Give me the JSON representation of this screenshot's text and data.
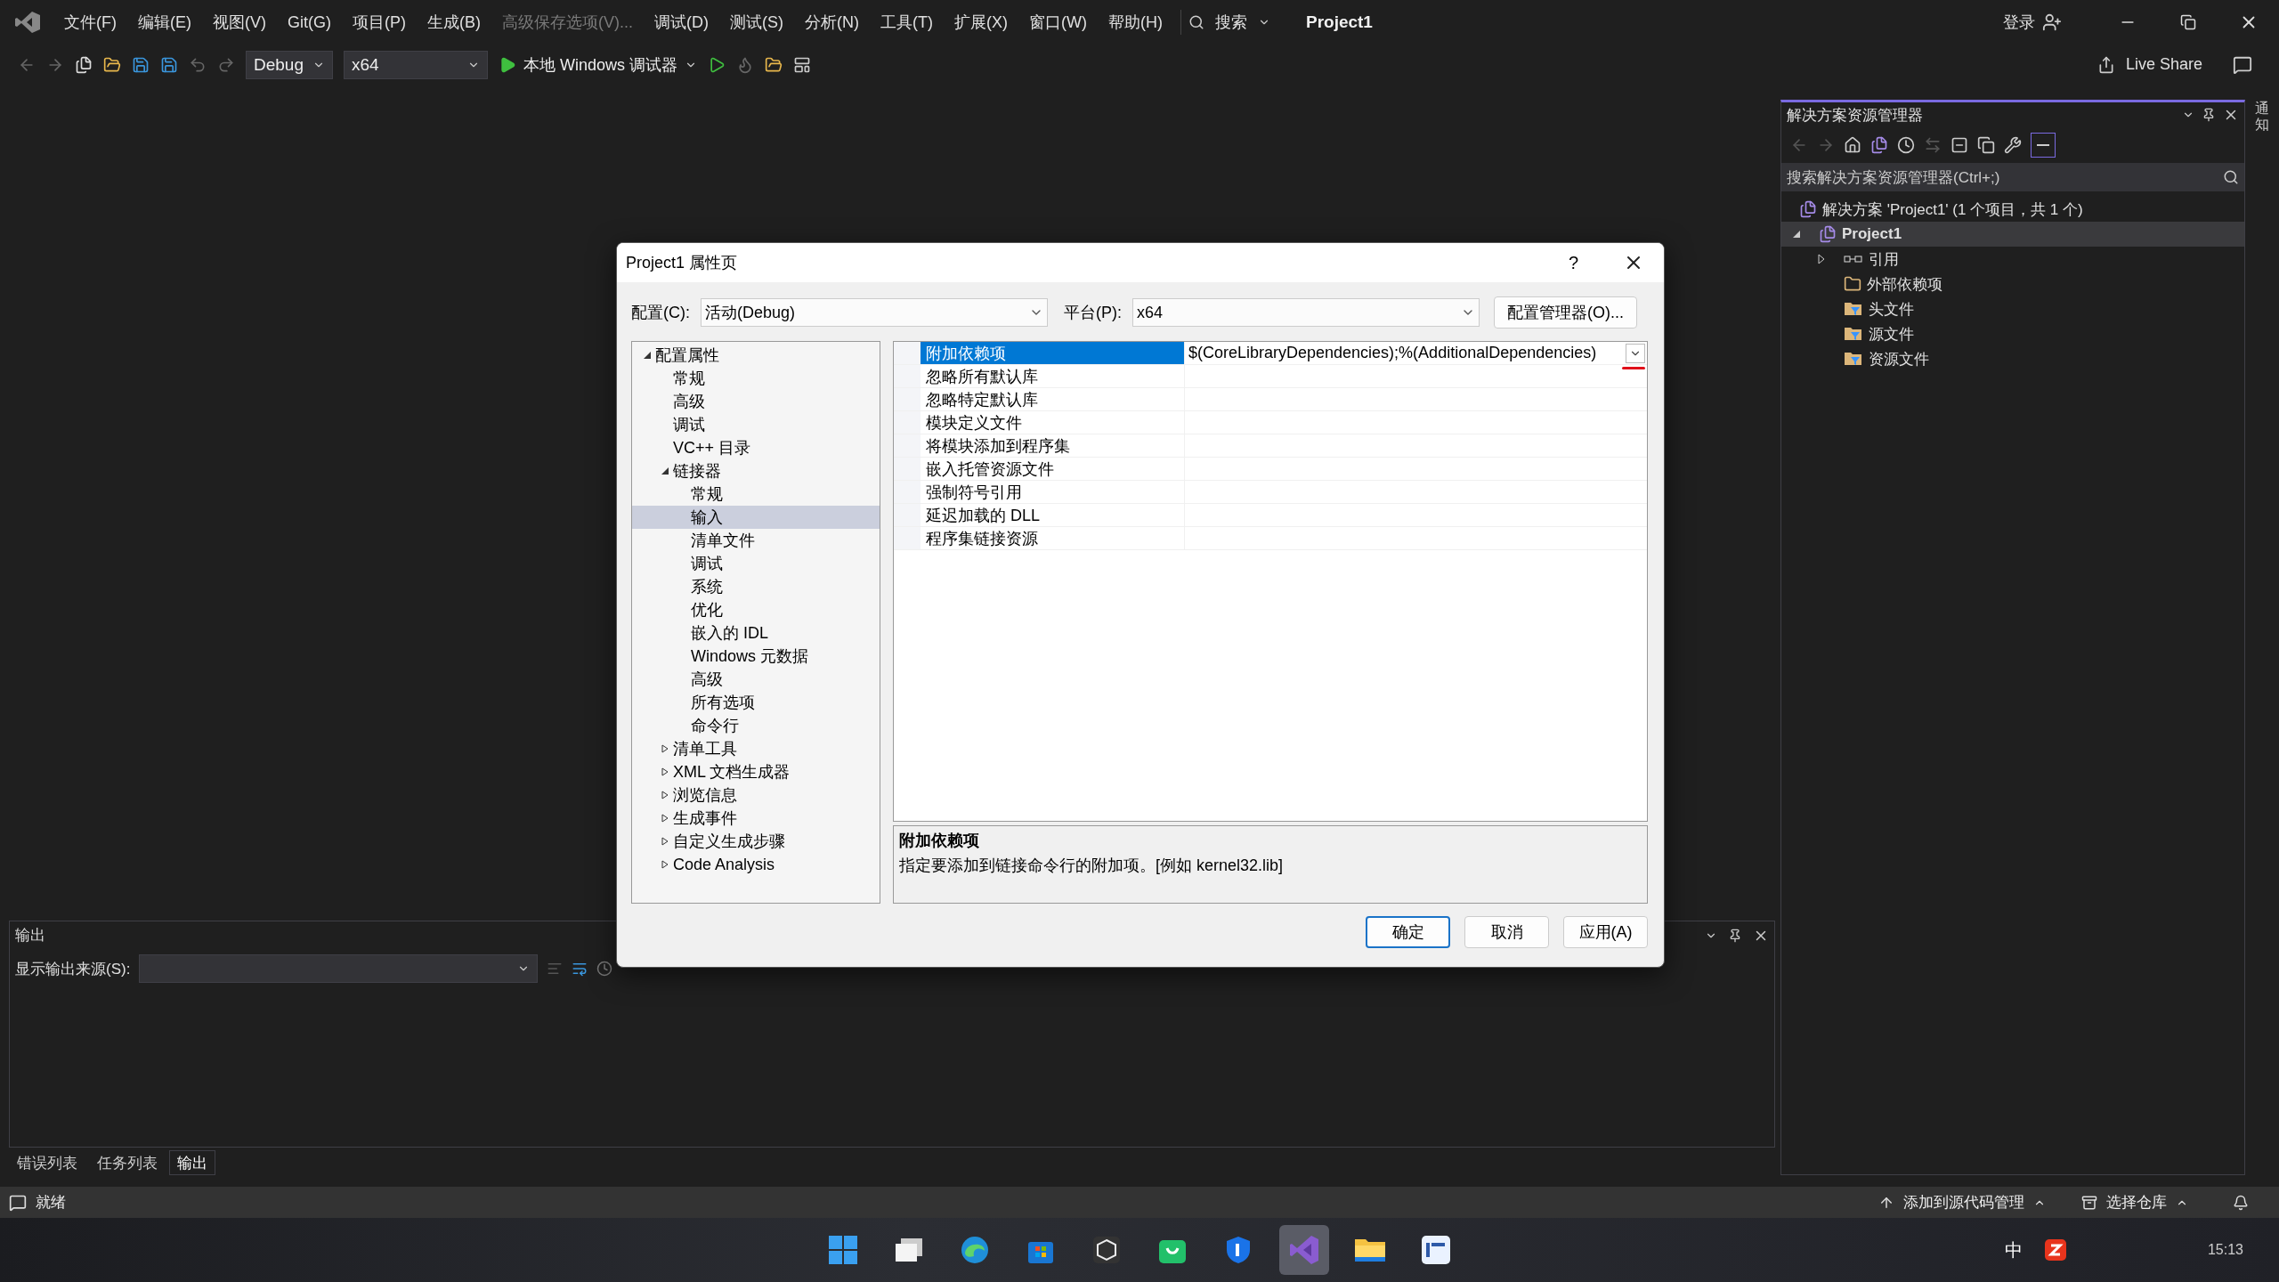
{
  "menu_bar": {
    "items": [
      {
        "label": "文件(F)",
        "disabled": false
      },
      {
        "label": "编辑(E)",
        "disabled": false
      },
      {
        "label": "视图(V)",
        "disabled": false
      },
      {
        "label": "Git(G)",
        "disabled": false
      },
      {
        "label": "项目(P)",
        "disabled": false
      },
      {
        "label": "生成(B)",
        "disabled": false
      },
      {
        "label": "高级保存选项(V)...",
        "disabled": true
      },
      {
        "label": "调试(D)",
        "disabled": false
      },
      {
        "label": "测试(S)",
        "disabled": false
      },
      {
        "label": "分析(N)",
        "disabled": false
      },
      {
        "label": "工具(T)",
        "disabled": false
      },
      {
        "label": "扩展(X)",
        "disabled": false
      },
      {
        "label": "窗口(W)",
        "disabled": false
      },
      {
        "label": "帮助(H)",
        "disabled": false
      }
    ],
    "search": "搜索",
    "title": "Project1",
    "sign_in": "登录"
  },
  "toolbar": {
    "configuration": "Debug",
    "platform": "x64",
    "run": "本地 Windows 调试器",
    "live_share": "Live Share"
  },
  "side_strip": {
    "label": "通知"
  },
  "solution_explorer": {
    "title": "解决方案资源管理器",
    "search_placeholder": "搜索解决方案资源管理器(Ctrl+;)",
    "solution": "解决方案 'Project1' (1 个项目，共 1 个)",
    "project": {
      "label": "Project1",
      "expanded": true,
      "selected": true,
      "children": [
        {
          "label": "引用",
          "kind": "reference",
          "expanded": false,
          "selected": false
        },
        {
          "label": "外部依赖项",
          "kind": "external",
          "selected": false
        },
        {
          "label": "头文件",
          "kind": "filter",
          "selected": false
        },
        {
          "label": "源文件",
          "kind": "filter",
          "selected": false
        },
        {
          "label": "资源文件",
          "kind": "filter",
          "selected": false
        }
      ]
    }
  },
  "dialog": {
    "title": "Project1 属性页",
    "help": "?",
    "config_label": "配置(C):",
    "config_value": "活动(Debug)",
    "platform_label": "平台(P):",
    "platform_value": "x64",
    "config_manager": "配置管理器(O)...",
    "tree": [
      {
        "label": "配置属性",
        "expanded": true,
        "selected": false,
        "children": [
          {
            "label": "常规",
            "selected": false
          },
          {
            "label": "高级",
            "selected": false
          },
          {
            "label": "调试",
            "selected": false
          },
          {
            "label": "VC++ 目录",
            "selected": false
          },
          {
            "label": "链接器",
            "expanded": true,
            "selected": false,
            "children": [
              {
                "label": "常规",
                "selected": false
              },
              {
                "label": "输入",
                "selected": true
              },
              {
                "label": "清单文件",
                "selected": false
              },
              {
                "label": "调试",
                "selected": false
              },
              {
                "label": "系统",
                "selected": false
              },
              {
                "label": "优化",
                "selected": false
              },
              {
                "label": "嵌入的 IDL",
                "selected": false
              },
              {
                "label": "Windows 元数据",
                "selected": false
              },
              {
                "label": "高级",
                "selected": false
              },
              {
                "label": "所有选项",
                "selected": false
              },
              {
                "label": "命令行",
                "selected": false
              }
            ]
          },
          {
            "label": "清单工具",
            "expanded": false,
            "selected": false
          },
          {
            "label": "XML 文档生成器",
            "expanded": false,
            "selected": false
          },
          {
            "label": "浏览信息",
            "expanded": false,
            "selected": false
          },
          {
            "label": "生成事件",
            "expanded": false,
            "selected": false
          },
          {
            "label": "自定义生成步骤",
            "expanded": false,
            "selected": false
          },
          {
            "label": "Code Analysis",
            "expanded": false,
            "selected": false
          }
        ]
      }
    ],
    "properties": [
      {
        "name": "附加依赖项",
        "value": "$(CoreLibraryDependencies);%(AdditionalDependencies)",
        "selected": true
      },
      {
        "name": "忽略所有默认库",
        "selected": false
      },
      {
        "name": "忽略特定默认库",
        "selected": false
      },
      {
        "name": "模块定义文件",
        "selected": false
      },
      {
        "name": "将模块添加到程序集",
        "selected": false
      },
      {
        "name": "嵌入托管资源文件",
        "selected": false
      },
      {
        "name": "强制符号引用",
        "selected": false
      },
      {
        "name": "延迟加载的 DLL",
        "selected": false
      },
      {
        "name": "程序集链接资源",
        "selected": false
      }
    ],
    "description_title": "附加依赖项",
    "description": "指定要添加到链接命令行的附加项。[例如 kernel32.lib]",
    "buttons": [
      {
        "label": "确定",
        "default": true
      },
      {
        "label": "取消",
        "default": false
      },
      {
        "label": "应用(A)",
        "default": false
      }
    ]
  },
  "output": {
    "title": "输出",
    "source_label": "显示输出来源(S):",
    "tabs": [
      {
        "label": "错误列表",
        "selected": false
      },
      {
        "label": "任务列表",
        "selected": false
      },
      {
        "label": "输出",
        "selected": true
      }
    ]
  },
  "status_bar": {
    "text": "就绪",
    "source_control": "添加到源代码管理",
    "repository": "选择仓库"
  },
  "taskbar": {
    "apps": [
      {
        "kind": "start",
        "selected": false
      },
      {
        "kind": "taskview",
        "selected": false
      },
      {
        "kind": "browser",
        "selected": false
      },
      {
        "kind": "store",
        "selected": false
      },
      {
        "kind": "cube",
        "selected": false
      },
      {
        "kind": "bag",
        "selected": false
      },
      {
        "kind": "shield",
        "selected": false
      },
      {
        "kind": "studio",
        "selected": true
      },
      {
        "kind": "folder",
        "selected": false
      },
      {
        "kind": "ps",
        "selected": false
      }
    ],
    "ime": "中",
    "time": "15:13"
  }
}
